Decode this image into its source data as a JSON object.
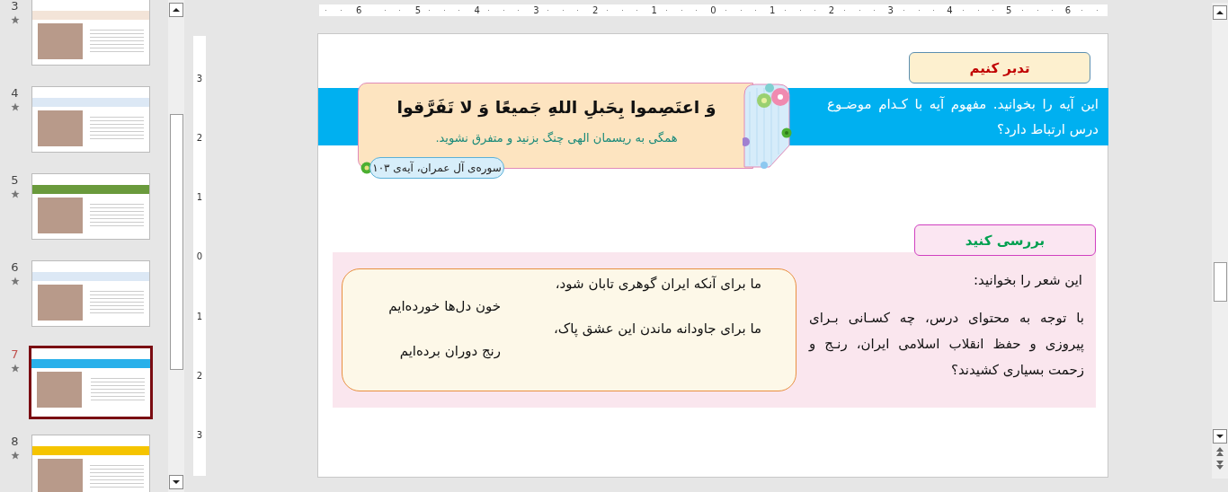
{
  "slide_panel": {
    "slides": [
      {
        "number": "3",
        "selected": false
      },
      {
        "number": "4",
        "selected": false
      },
      {
        "number": "5",
        "selected": false
      },
      {
        "number": "6",
        "selected": false
      },
      {
        "number": "7",
        "selected": true
      },
      {
        "number": "8",
        "selected": false
      }
    ]
  },
  "rulers": {
    "horizontal": {
      "right_of_zero": [
        "6",
        "5",
        "4",
        "3",
        "2",
        "1"
      ],
      "zero": "0",
      "left_of_zero": [
        "1",
        "2",
        "3",
        "4",
        "5",
        "6"
      ]
    },
    "vertical": [
      "3",
      "2",
      "1",
      "0",
      "1",
      "2",
      "3"
    ]
  },
  "slide": {
    "reflect_title": "تدبر کنیم",
    "reflect_prompt": "این آیه را بخوانید. مفهوم آیه با کـدام موضـوع درس ارتباط دارد؟",
    "verse": "وَ اعتَصِموا بِحَبلِ اللهِ جَميعًا وَ لا تَفَرَّقوا",
    "translation": "همگی به ریسمان الهی چنگ بزنید و متفرق نشوید.",
    "reference": "سوره‌ی آل عمران، آیه‌ی ۱۰۳",
    "review_title": "بررسی کنید",
    "review_intro": "این شعر را بخوانید:",
    "review_question": "با توجه به محتوای درس، چه کسـانی بـرای پیروزی و حفظ انقلاب اسلامی ایران، رنـج و زحمت بسیاری کشیدند؟",
    "poem": [
      "ما برای آنکه ایران گوهری تابان شود،",
      "خون دل‌ها خورده‌ایم",
      "ما برای جاودانه ماندن این عشق پاک،",
      "رنج دوران برده‌ایم"
    ]
  }
}
